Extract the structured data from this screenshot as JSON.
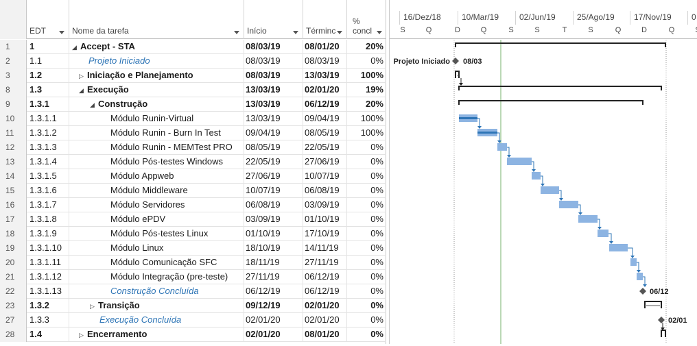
{
  "columns": {
    "id": "",
    "wbs": "EDT",
    "name": "Nome da tarefa",
    "start": "Início",
    "end": "Términc",
    "pct_line1": "%",
    "pct_line2": "concl"
  },
  "timescale": {
    "top": [
      "16/Dez/18",
      "10/Mar/19",
      "02/Jun/19",
      "25/Ago/19",
      "17/Nov/19",
      "0"
    ],
    "bottom": [
      "S",
      "Q",
      "D",
      "Q",
      "S",
      "S",
      "T",
      "S",
      "Q",
      "D",
      "Q",
      "S"
    ]
  },
  "rows": [
    {
      "id": "1",
      "wbs": "1",
      "name": "Accept - STA",
      "start": "08/03/19",
      "end": "08/01/20",
      "pct": "20%",
      "bold": true,
      "indent": 0,
      "tri": "◢",
      "ms": false
    },
    {
      "id": "2",
      "wbs": "1.1",
      "name": "Projeto Iniciado",
      "start": "08/03/19",
      "end": "08/03/19",
      "pct": "0%",
      "bold": false,
      "indent": 1,
      "tri": "",
      "ms": true
    },
    {
      "id": "3",
      "wbs": "1.2",
      "name": "Iniciação e Planejamento",
      "start": "08/03/19",
      "end": "13/03/19",
      "pct": "100%",
      "bold": true,
      "indent": 1,
      "tri": "▷",
      "ms": false
    },
    {
      "id": "8",
      "wbs": "1.3",
      "name": "Execução",
      "start": "13/03/19",
      "end": "02/01/20",
      "pct": "19%",
      "bold": true,
      "indent": 1,
      "tri": "◢",
      "ms": false
    },
    {
      "id": "9",
      "wbs": "1.3.1",
      "name": "Construção",
      "start": "13/03/19",
      "end": "06/12/19",
      "pct": "20%",
      "bold": true,
      "indent": 2,
      "tri": "◢",
      "ms": false
    },
    {
      "id": "10",
      "wbs": "1.3.1.1",
      "name": "Módulo Runin-Virtual",
      "start": "13/03/19",
      "end": "09/04/19",
      "pct": "100%",
      "bold": false,
      "indent": 3,
      "tri": "",
      "ms": false
    },
    {
      "id": "11",
      "wbs": "1.3.1.2",
      "name": "Módulo Runin - Burn In Test",
      "start": "09/04/19",
      "end": "08/05/19",
      "pct": "100%",
      "bold": false,
      "indent": 3,
      "tri": "",
      "ms": false
    },
    {
      "id": "12",
      "wbs": "1.3.1.3",
      "name": "Módulo Runin - MEMTest PRO",
      "start": "08/05/19",
      "end": "22/05/19",
      "pct": "0%",
      "bold": false,
      "indent": 3,
      "tri": "",
      "ms": false
    },
    {
      "id": "13",
      "wbs": "1.3.1.4",
      "name": "Módulo Pós-testes Windows",
      "start": "22/05/19",
      "end": "27/06/19",
      "pct": "0%",
      "bold": false,
      "indent": 3,
      "tri": "",
      "ms": false
    },
    {
      "id": "14",
      "wbs": "1.3.1.5",
      "name": "Módulo Appweb",
      "start": "27/06/19",
      "end": "10/07/19",
      "pct": "0%",
      "bold": false,
      "indent": 3,
      "tri": "",
      "ms": false
    },
    {
      "id": "15",
      "wbs": "1.3.1.6",
      "name": "Módulo Middleware",
      "start": "10/07/19",
      "end": "06/08/19",
      "pct": "0%",
      "bold": false,
      "indent": 3,
      "tri": "",
      "ms": false
    },
    {
      "id": "16",
      "wbs": "1.3.1.7",
      "name": "Módulo Servidores",
      "start": "06/08/19",
      "end": "03/09/19",
      "pct": "0%",
      "bold": false,
      "indent": 3,
      "tri": "",
      "ms": false
    },
    {
      "id": "17",
      "wbs": "1.3.1.8",
      "name": "Módulo ePDV",
      "start": "03/09/19",
      "end": "01/10/19",
      "pct": "0%",
      "bold": false,
      "indent": 3,
      "tri": "",
      "ms": false
    },
    {
      "id": "18",
      "wbs": "1.3.1.9",
      "name": "Módulo Pós-testes Linux",
      "start": "01/10/19",
      "end": "17/10/19",
      "pct": "0%",
      "bold": false,
      "indent": 3,
      "tri": "",
      "ms": false
    },
    {
      "id": "19",
      "wbs": "1.3.1.10",
      "name": "Módulo Linux",
      "start": "18/10/19",
      "end": "14/11/19",
      "pct": "0%",
      "bold": false,
      "indent": 3,
      "tri": "",
      "ms": false
    },
    {
      "id": "20",
      "wbs": "1.3.1.11",
      "name": "Módulo Comunicação SFC",
      "start": "18/11/19",
      "end": "27/11/19",
      "pct": "0%",
      "bold": false,
      "indent": 3,
      "tri": "",
      "ms": false
    },
    {
      "id": "21",
      "wbs": "1.3.1.12",
      "name": "Módulo Integração (pre-teste)",
      "start": "27/11/19",
      "end": "06/12/19",
      "pct": "0%",
      "bold": false,
      "indent": 3,
      "tri": "",
      "ms": false
    },
    {
      "id": "22",
      "wbs": "1.3.1.13",
      "name": "Construção Concluída",
      "start": "06/12/19",
      "end": "06/12/19",
      "pct": "0%",
      "bold": false,
      "indent": 3,
      "tri": "",
      "ms": true
    },
    {
      "id": "23",
      "wbs": "1.3.2",
      "name": "Transição",
      "start": "09/12/19",
      "end": "02/01/20",
      "pct": "0%",
      "bold": true,
      "indent": 2,
      "tri": "▷",
      "ms": false
    },
    {
      "id": "27",
      "wbs": "1.3.3",
      "name": "Execução Concluída",
      "start": "02/01/20",
      "end": "02/01/20",
      "pct": "0%",
      "bold": false,
      "indent": 2,
      "tri": "",
      "ms": true
    },
    {
      "id": "28",
      "wbs": "1.4",
      "name": "Encerramento",
      "start": "02/01/20",
      "end": "08/01/20",
      "pct": "0%",
      "bold": true,
      "indent": 1,
      "tri": "▷",
      "ms": false
    }
  ],
  "gantt_labels": {
    "milestone_project": "Projeto Iniciado",
    "milestone_project_date": "08/03",
    "milestone_construction_date": "06/12",
    "milestone_execution_date": "02/01"
  },
  "colors": {
    "bar": "#8db4e2",
    "bar_progress": "#2e75b6",
    "milestone_text": "#2e75b6",
    "today_line": "#76b26b"
  }
}
